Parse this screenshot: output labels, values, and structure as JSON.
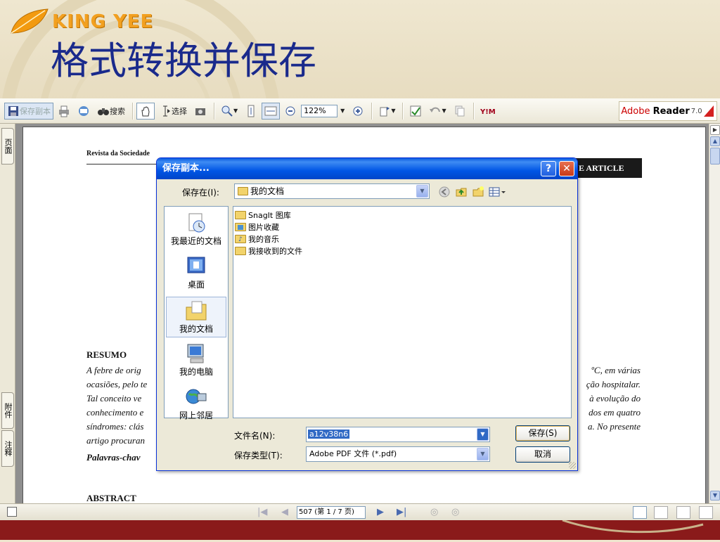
{
  "slide": {
    "brand": "KING YEE",
    "title": "格式转换并保存"
  },
  "toolbar": {
    "save_copy_label": "保存副本",
    "search_label": "搜索",
    "select_label": "选择",
    "zoom_value": "122%",
    "adobe_brand": "Adobe",
    "reader_label": "Reader",
    "version": "7.0"
  },
  "nav_tabs": {
    "pages": "页面",
    "attachments": "附件",
    "comments": "注释"
  },
  "document": {
    "journal_header": "Revista da Sociedade",
    "article_tag": "E ARTICLE",
    "resumo_heading": "RESUMO",
    "left_lines": [
      "A febre de orig",
      "ocasiões, pelo te",
      "Tal conceito ve",
      "conhecimento e",
      "síndromes: clás",
      "artigo procuran"
    ],
    "right_lines": [
      "ºC, em várias",
      "ção hospitalar.",
      "à evolução do",
      "dos em quatro",
      "a. No presente"
    ],
    "keywords_fragment": "Palavras-chav",
    "abstract_heading": "ABSTRACT"
  },
  "statusbar": {
    "page_indicator": "507 (第 1 / 7 页)"
  },
  "dialog": {
    "title": "保存副本...",
    "help_label": "?",
    "close_label": "✕",
    "save_in_label": "保存在(I):",
    "save_in_value": "我的文档",
    "places": [
      {
        "label": "我最近的文档"
      },
      {
        "label": "桌面"
      },
      {
        "label": "我的文档"
      },
      {
        "label": "我的电脑"
      },
      {
        "label": "网上邻居"
      }
    ],
    "files": [
      {
        "name": "SnagIt 图库",
        "icon": "folder"
      },
      {
        "name": "图片收藏",
        "icon": "pictures-folder"
      },
      {
        "name": "我的音乐",
        "icon": "music-folder"
      },
      {
        "name": "我接收到的文件",
        "icon": "folder"
      }
    ],
    "filename_label": "文件名(N):",
    "filename_value": "a12v38n6",
    "filetype_label": "保存类型(T):",
    "filetype_value": "Adobe PDF 文件 (*.pdf)",
    "save_button": "保存(S)",
    "cancel_button": "取消"
  },
  "colors": {
    "title_blue": "#1a2a8c",
    "brand_orange": "#f2a020",
    "dialog_title_blue": "#0055e5",
    "slide_bottom_red": "#8a1a1a"
  }
}
